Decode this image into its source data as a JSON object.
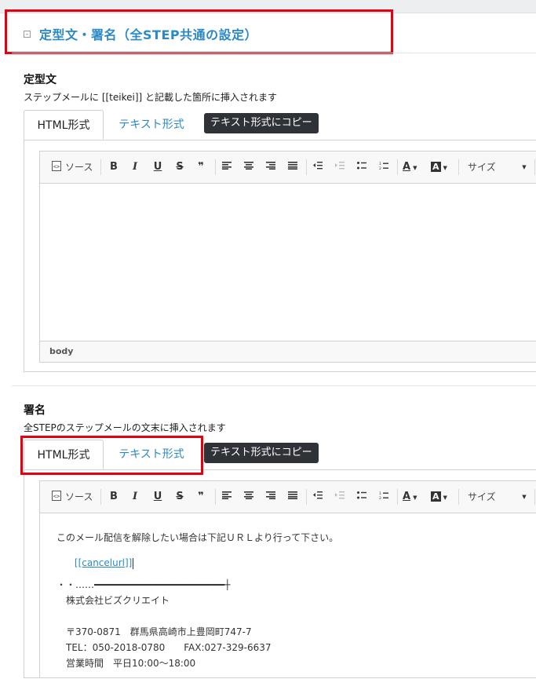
{
  "section": {
    "collapse_glyph": "-",
    "title": "定型文・署名（全STEP共通の設定）"
  },
  "teikei": {
    "label": "定型文",
    "description": "ステップメールに [[teikei]] と記載した箇所に挿入されます",
    "tabs": [
      "HTML形式",
      "テキスト形式"
    ],
    "copy_button": "テキスト形式にコピー",
    "status": "body"
  },
  "signature": {
    "label": "署名",
    "description": "全STEPのステップメールの文末に挿入されます",
    "tabs": [
      "HTML形式",
      "テキスト形式"
    ],
    "copy_button": "テキスト形式にコピー",
    "lines": [
      "このメール配信を解除したい場合は下記ＵＲＬより行って下さい。",
      "[[cancelurl]]",
      "・・……━━━━━━━━━━━━━━━━━━━━━━━┼",
      "株式会社ビズクリエイト",
      "〒370-0871　群馬県高崎市上豊岡町747-7",
      "TEL：050-2018-0780　　FAX:027-329-6637",
      "営業時間　平日10:00～18:00"
    ]
  },
  "toolbar": {
    "source": "ソース",
    "bold": "B",
    "italic": "I",
    "underline": "U",
    "strike": "S",
    "quote": "❞",
    "size": "サイズ",
    "font_color": "A",
    "bg_color": "A"
  },
  "colors": {
    "accent": "#2b8ac6",
    "highlight_box": "#e60012",
    "copy_button_bg": "#2f3338"
  }
}
